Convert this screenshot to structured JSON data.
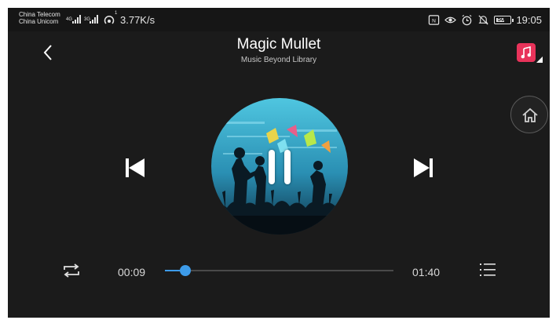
{
  "status_bar": {
    "carrier_1": "China Telecom",
    "carrier_2": "China Unicom",
    "sig1_tag": "4G",
    "sig2_tag": "3G",
    "wifi_tag": "1",
    "speed": "3.77K/s",
    "battery": "50",
    "time": "19:05",
    "icons": [
      "nfc-icon",
      "eye-icon",
      "alarm-icon",
      "mute-icon",
      "battery-icon"
    ]
  },
  "header": {
    "title": "Magic Mullet",
    "subtitle": "Music Beyond Library"
  },
  "player": {
    "elapsed": "00:09",
    "total": "01:40",
    "progress": 0.09,
    "is_playing": true
  },
  "colors": {
    "background": "#1b1b1b",
    "accent": "#3d9be9",
    "app_icon": "#e8335a"
  }
}
